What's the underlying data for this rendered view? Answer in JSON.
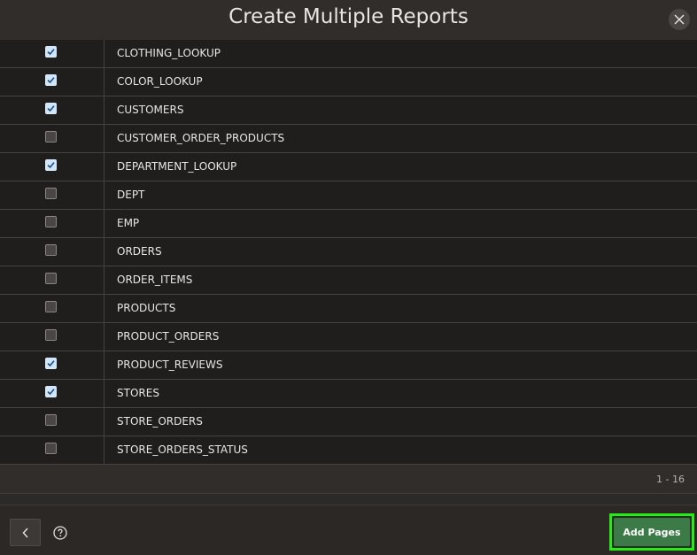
{
  "dialog": {
    "title": "Create Multiple Reports"
  },
  "table": {
    "rows": [
      {
        "name": "CLOTHING_LOOKUP",
        "checked": true
      },
      {
        "name": "COLOR_LOOKUP",
        "checked": true
      },
      {
        "name": "CUSTOMERS",
        "checked": true
      },
      {
        "name": "CUSTOMER_ORDER_PRODUCTS",
        "checked": false
      },
      {
        "name": "DEPARTMENT_LOOKUP",
        "checked": true
      },
      {
        "name": "DEPT",
        "checked": false
      },
      {
        "name": "EMP",
        "checked": false
      },
      {
        "name": "ORDERS",
        "checked": false
      },
      {
        "name": "ORDER_ITEMS",
        "checked": false
      },
      {
        "name": "PRODUCTS",
        "checked": false
      },
      {
        "name": "PRODUCT_ORDERS",
        "checked": false
      },
      {
        "name": "PRODUCT_REVIEWS",
        "checked": true
      },
      {
        "name": "STORES",
        "checked": true
      },
      {
        "name": "STORE_ORDERS",
        "checked": false
      },
      {
        "name": "STORE_ORDERS_STATUS",
        "checked": false
      }
    ]
  },
  "pager": {
    "range": "1 - 16"
  },
  "footer": {
    "add_label": "Add Pages",
    "back_icon": "chevron-left-icon",
    "help_icon": "help-circle-icon"
  },
  "colors": {
    "checkbox_checked": "#cfe6fd",
    "add_button": "#3c7a48",
    "highlight": "#22ee11"
  }
}
